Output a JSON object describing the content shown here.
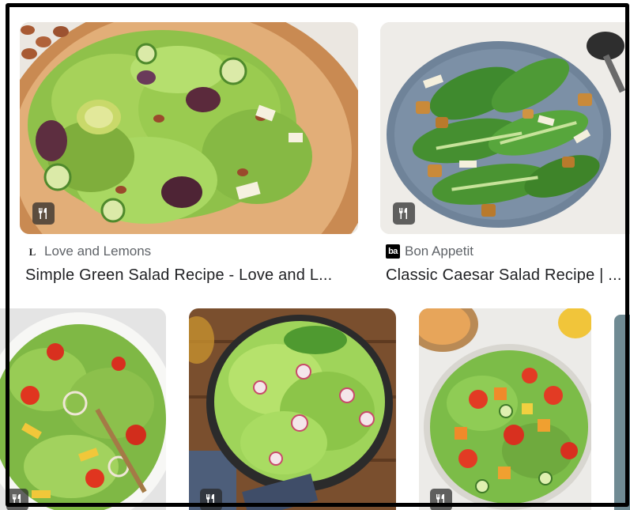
{
  "results": [
    {
      "source": "Love and Lemons",
      "source_logo": "L",
      "title": "Simple Green Salad Recipe - Love and L...",
      "badge_icon": "fork-knife-icon"
    },
    {
      "source": "Bon Appetit",
      "source_logo": "ba",
      "title": "Classic Caesar Salad Recipe | ...",
      "badge_icon": "fork-knife-icon"
    }
  ],
  "colors": {
    "badge_bg": "#3a3a3a",
    "title_text": "#202124",
    "source_text": "#5f6368"
  }
}
